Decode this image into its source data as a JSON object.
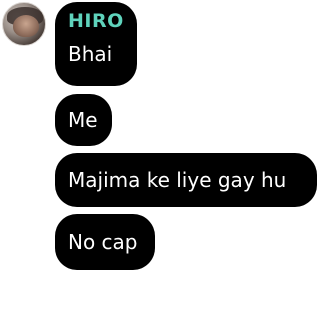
{
  "chat": {
    "messages": [
      {
        "sender": "HIRO",
        "text": "Bhai"
      },
      {
        "text": "Me"
      },
      {
        "text": "Majima ke liye gay hu"
      },
      {
        "text": "No cap"
      }
    ]
  },
  "colors": {
    "bubble_background": "#000000",
    "bubble_text": "#ffffff",
    "sender_name": "#5fd3bc",
    "page_background": "#ffffff"
  },
  "icons": {
    "avatar": "user-avatar-photo"
  }
}
